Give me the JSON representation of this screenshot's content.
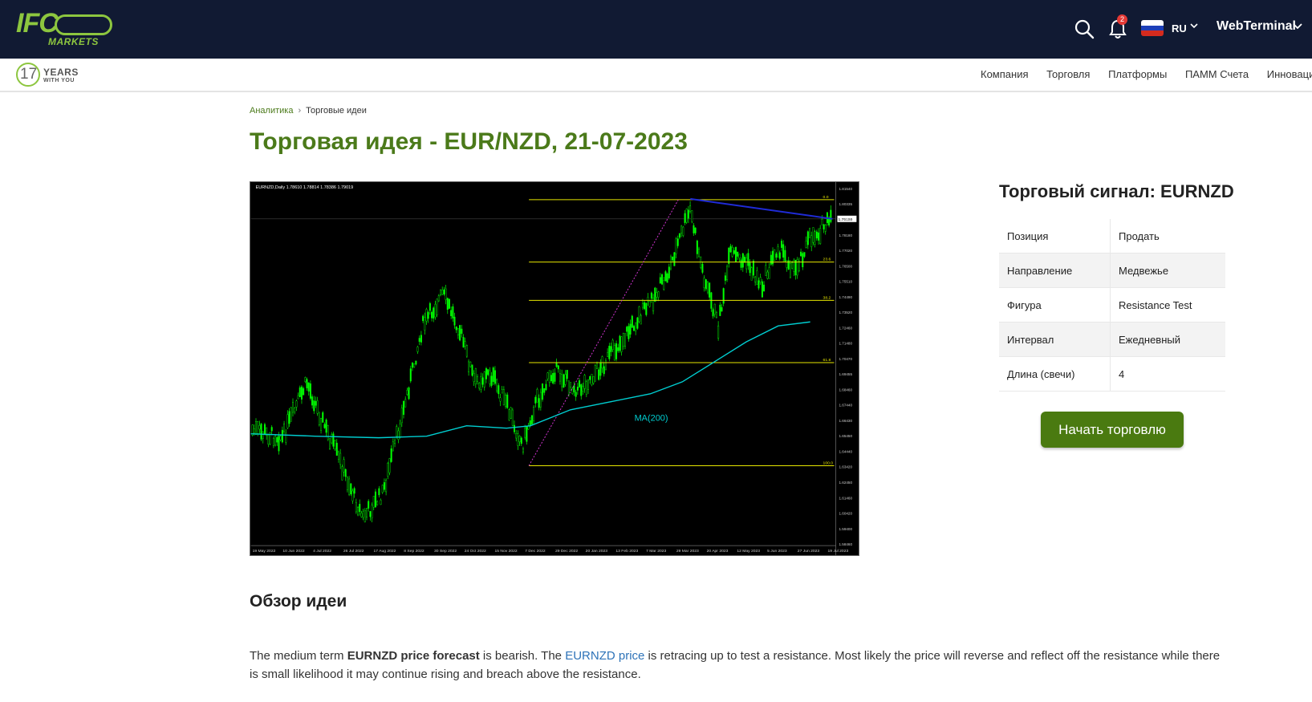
{
  "header": {
    "logo_text": "IFC",
    "logo_sub": "MARKETS",
    "notifications_count": "2",
    "language": "RU",
    "webterminal": "WebTerminal"
  },
  "subnav": {
    "years_number": "17",
    "years_word": "YEARS",
    "years_tagline": "WITH YOU",
    "items": [
      "Компания",
      "Торговля",
      "Платформы",
      "ПАММ Счета",
      "Инновации"
    ]
  },
  "breadcrumb": {
    "parent": "Аналитика",
    "sep": "›",
    "current": "Торговые идеи"
  },
  "page_title": "Торговая идея - EUR/NZD, 21-07-2023",
  "chart": {
    "header": "EURNZD,Daily 1.78610 1.78814 1.78386 1.79019",
    "ma_label": "MA(200)",
    "y_ticks": [
      "1.81540",
      "1.80335",
      "1.79155",
      "1.78180",
      "1.77020",
      "1.76500",
      "1.75510",
      "1.74490",
      "1.73520",
      "1.72460",
      "1.71480",
      "1.70470",
      "1.69455",
      "1.68460",
      "1.67440",
      "1.66430",
      "1.65450",
      "1.64440",
      "1.63420",
      "1.62450",
      "1.61460",
      "1.60420",
      "1.59400",
      "1.58460"
    ],
    "x_ticks": [
      "19 May 2022",
      "10 Jun 2022",
      "4 Jul 2022",
      "26 Jul 2022",
      "17 Aug 2022",
      "8 Sep 2022",
      "30 Sep 2022",
      "24 Oct 2022",
      "15 Nov 2022",
      "7 Dec 2022",
      "29 Dec 2022",
      "20 Jan 2023",
      "13 Feb 2023",
      "7 Mar 2023",
      "29 Mar 2023",
      "20 Apr 2023",
      "12 May 2023",
      "5 Jun 2023",
      "27 Jun 2023",
      "19 Jul 2023"
    ],
    "fib_levels": [
      "0.0",
      "23.6",
      "38.2",
      "61.8",
      "100.0"
    ],
    "price_tag": "1.79155"
  },
  "signal": {
    "title": "Торговый сигнал: EURNZD",
    "rows": [
      {
        "k": "Позиция",
        "v": "Продать"
      },
      {
        "k": "Направление",
        "v": "Медвежье"
      },
      {
        "k": "Фигура",
        "v": "Resistance Test"
      },
      {
        "k": "Интервал",
        "v": "Ежедневный"
      },
      {
        "k": "Длина (свечи)",
        "v": "4"
      }
    ],
    "cta": "Начать торговлю"
  },
  "overview": {
    "heading": "Обзор идеи",
    "p1": "The medium term ",
    "p_bold": "EURNZD price forecast",
    "p2": " is bearish. The ",
    "p_link": "EURNZD price",
    "p3": " is retracing up to test a resistance. Most likely the price will reverse and reflect off the resistance while there is small likelihood it may continue rising and breach above the resistance."
  },
  "colors": {
    "topbar": "#111a33",
    "brand_green": "#8dc63f",
    "title_green": "#4b7a1a",
    "cta_green": "#4a7a10",
    "link_blue": "#2e73b8",
    "candle_green": "#00ff00",
    "ma_cyan": "#00ced1",
    "fib_yellow": "#e6e600",
    "trend_blue": "#1f2bd6"
  },
  "icons": [
    "search-icon",
    "bell-icon",
    "russia-flag-icon",
    "chevron-down-icon"
  ]
}
